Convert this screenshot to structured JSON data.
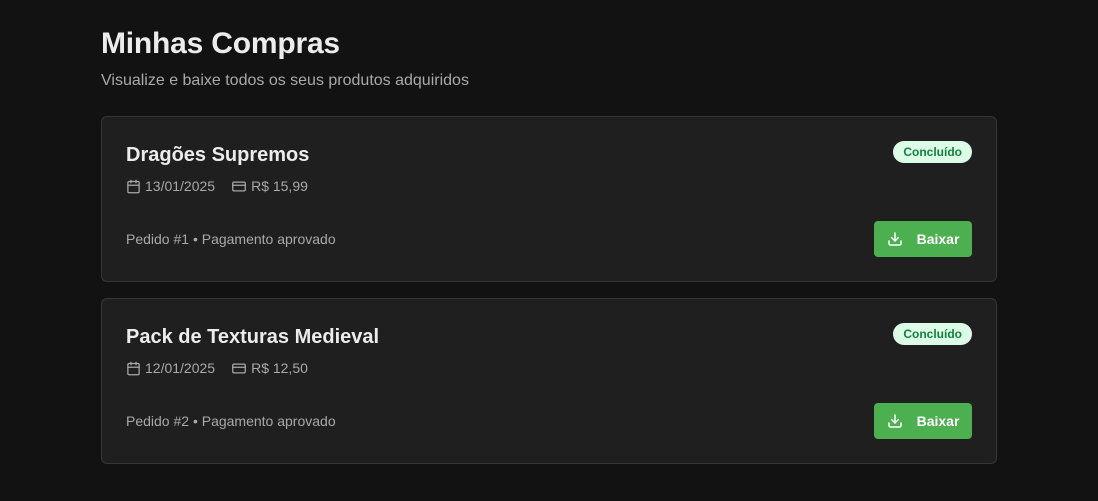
{
  "header": {
    "title": "Minhas Compras",
    "subtitle": "Visualize e baixe todos os seus produtos adquiridos"
  },
  "orders": [
    {
      "product": "Dragões Supremos",
      "status": "Concluído",
      "date": "13/01/2025",
      "price": "R$ 15,99",
      "info": "Pedido #1 • Pagamento aprovado",
      "download_label": "Baixar"
    },
    {
      "product": "Pack de Texturas Medieval",
      "status": "Concluído",
      "date": "12/01/2025",
      "price": "R$ 12,50",
      "info": "Pedido #2 • Pagamento aprovado",
      "download_label": "Baixar"
    }
  ],
  "icons": {
    "date": "calendar-icon",
    "price": "credit-card-icon",
    "download": "download-icon"
  },
  "colors": {
    "background": "#121212",
    "card": "#1f1f1f",
    "accent": "#4caf50",
    "badge_bg": "#dcfce7",
    "badge_text": "#15803d"
  }
}
